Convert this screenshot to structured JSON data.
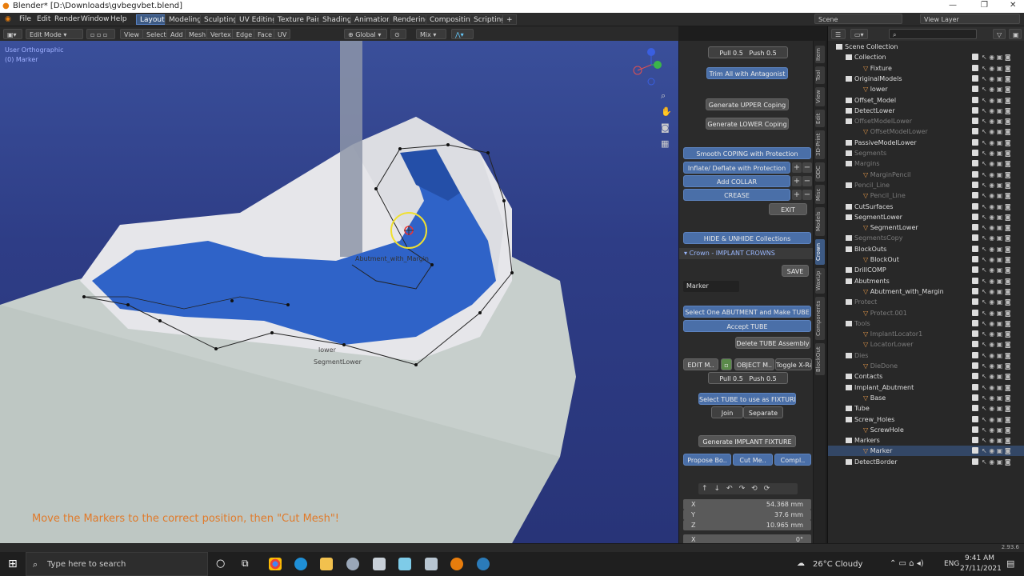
{
  "window": {
    "title": "Blender* [D:\\Downloads\\gvbegvbet.blend]",
    "minimize": "—",
    "maximize": "❐",
    "close": "✕"
  },
  "menu": {
    "items": [
      "File",
      "Edit",
      "Render",
      "Window",
      "Help"
    ]
  },
  "workspaces": [
    "Layout",
    "Modeling",
    "Sculpting",
    "UV Editing",
    "Texture Paint",
    "Shading",
    "Animation",
    "Rendering",
    "Compositing",
    "Scripting",
    "+"
  ],
  "scene": {
    "name": "Scene",
    "view_layer": "View Layer"
  },
  "viewport_header": {
    "mode": "Edit Mode",
    "menus": [
      "View",
      "Select",
      "Add",
      "Mesh",
      "Vertex",
      "Edge",
      "Face",
      "UV"
    ],
    "orientation": "Global",
    "pivot": "Mix"
  },
  "viewport": {
    "view_name": "User Orthographic",
    "object_name": "(0) Marker",
    "labels": {
      "abutment": "Abutment_with_Margin",
      "lower": "lower",
      "segment": "SegmentLower"
    },
    "hint": "Move the Markers to the correct position, then \"Cut Mesh\"!"
  },
  "panel": {
    "pull_top": "Pull 0.5",
    "push_top": "Push 0.5",
    "trim": "Trim All with Antagonist",
    "gen_upper": "Generate  UPPER Coping",
    "gen_lower": "Generate LOWER Coping",
    "smooth": "Smooth COPING with Protection",
    "inflate": "Inflate/ Deflate with Protection",
    "add_collar": "Add COLLAR",
    "crease": "CREASE",
    "exit": "EXIT",
    "hide": "HIDE & UNHIDE Collections",
    "section": "Crown - IMPLANT CROWNS",
    "save": "SAVE",
    "name_field": "Marker",
    "select_abutment": "Select One ABUTMENT and Make TUBE",
    "accept_tube": "Accept TUBE",
    "delete_tube": "Delete TUBE Assembly",
    "edit_mode": "EDIT M..",
    "object_mode": "OBJECT M..",
    "xray": "Toggle X-Ray",
    "pull_mid": "Pull 0.5",
    "push_mid": "Push 0.5",
    "select_tube": "Select TUBE to use as FIXTURE",
    "join": "Join",
    "separate": "Separate",
    "gen_fixture": "Generate IMPLANT FIXTURE",
    "propose": "Propose Bo..",
    "cut_mesh": "Cut Me..",
    "complete": "Compl..",
    "coords": [
      {
        "label": "X",
        "value": "54.368 mm"
      },
      {
        "label": "Y",
        "value": "37.6 mm"
      },
      {
        "label": "Z",
        "value": "10.965 mm"
      },
      {
        "label": "X",
        "value": "0°"
      }
    ]
  },
  "side_tabs": [
    "Item",
    "Tool",
    "View",
    "Edit",
    "3D-Print",
    "ODC",
    "Misc",
    "Models",
    "Crown",
    "WaxUp",
    "Components",
    "BlockOut"
  ],
  "outliner": {
    "rows": [
      {
        "name": "Scene Collection",
        "indent": 0,
        "kind": "root"
      },
      {
        "name": "Collection",
        "indent": 1,
        "kind": "coll"
      },
      {
        "name": "Fixture",
        "indent": 2,
        "kind": "obj"
      },
      {
        "name": "OriginalModels",
        "indent": 1,
        "kind": "coll"
      },
      {
        "name": "lower",
        "indent": 2,
        "kind": "obj"
      },
      {
        "name": "Offset_Model",
        "indent": 1,
        "kind": "coll"
      },
      {
        "name": "DetectLower",
        "indent": 1,
        "kind": "coll"
      },
      {
        "name": "OffsetModelLower",
        "indent": 1,
        "kind": "coll",
        "dim": true
      },
      {
        "name": "OffsetModelLower",
        "indent": 2,
        "kind": "obj",
        "dim": true
      },
      {
        "name": "PassiveModelLower",
        "indent": 1,
        "kind": "coll"
      },
      {
        "name": "Segments",
        "indent": 1,
        "kind": "coll",
        "dim": true
      },
      {
        "name": "Margins",
        "indent": 1,
        "kind": "coll",
        "dim": true
      },
      {
        "name": "MarginPencil",
        "indent": 2,
        "kind": "obj",
        "dim": true
      },
      {
        "name": "Pencil_Line",
        "indent": 1,
        "kind": "coll",
        "dim": true
      },
      {
        "name": "Pencil_Line",
        "indent": 2,
        "kind": "obj",
        "dim": true
      },
      {
        "name": "CutSurfaces",
        "indent": 1,
        "kind": "coll"
      },
      {
        "name": "SegmentLower",
        "indent": 1,
        "kind": "coll"
      },
      {
        "name": "SegmentLower",
        "indent": 2,
        "kind": "obj"
      },
      {
        "name": "SegmentsCopy",
        "indent": 1,
        "kind": "coll",
        "dim": true
      },
      {
        "name": "BlockOuts",
        "indent": 1,
        "kind": "coll"
      },
      {
        "name": "BlockOut",
        "indent": 2,
        "kind": "obj"
      },
      {
        "name": "DrillCOMP",
        "indent": 1,
        "kind": "coll"
      },
      {
        "name": "Abutments",
        "indent": 1,
        "kind": "coll"
      },
      {
        "name": "Abutment_with_Margin",
        "indent": 2,
        "kind": "obj"
      },
      {
        "name": "Protect",
        "indent": 1,
        "kind": "coll",
        "dim": true
      },
      {
        "name": "Protect.001",
        "indent": 2,
        "kind": "obj",
        "dim": true
      },
      {
        "name": "Tools",
        "indent": 1,
        "kind": "coll",
        "dim": true
      },
      {
        "name": "ImplantLocator1",
        "indent": 2,
        "kind": "obj",
        "dim": true
      },
      {
        "name": "LocatorLower",
        "indent": 2,
        "kind": "obj",
        "dim": true
      },
      {
        "name": "Dies",
        "indent": 1,
        "kind": "coll",
        "dim": true
      },
      {
        "name": "DieDone",
        "indent": 2,
        "kind": "obj",
        "dim": true
      },
      {
        "name": "Contacts",
        "indent": 1,
        "kind": "coll"
      },
      {
        "name": "Implant_Abutment",
        "indent": 1,
        "kind": "coll"
      },
      {
        "name": "Base",
        "indent": 2,
        "kind": "obj"
      },
      {
        "name": "Tube",
        "indent": 1,
        "kind": "coll"
      },
      {
        "name": "Screw_Holes",
        "indent": 1,
        "kind": "coll"
      },
      {
        "name": "ScrewHole",
        "indent": 2,
        "kind": "obj"
      },
      {
        "name": "Markers",
        "indent": 1,
        "kind": "coll"
      },
      {
        "name": "Marker",
        "indent": 2,
        "kind": "obj",
        "selected": true
      },
      {
        "name": "DetectBorder",
        "indent": 1,
        "kind": "coll"
      }
    ]
  },
  "status": {
    "version": "2.93.6"
  },
  "taskbar": {
    "search_placeholder": "Type here to search",
    "weather": "26°C  Cloudy",
    "lang": "ENG",
    "time": "9:41 AM",
    "date": "27/11/2021"
  }
}
